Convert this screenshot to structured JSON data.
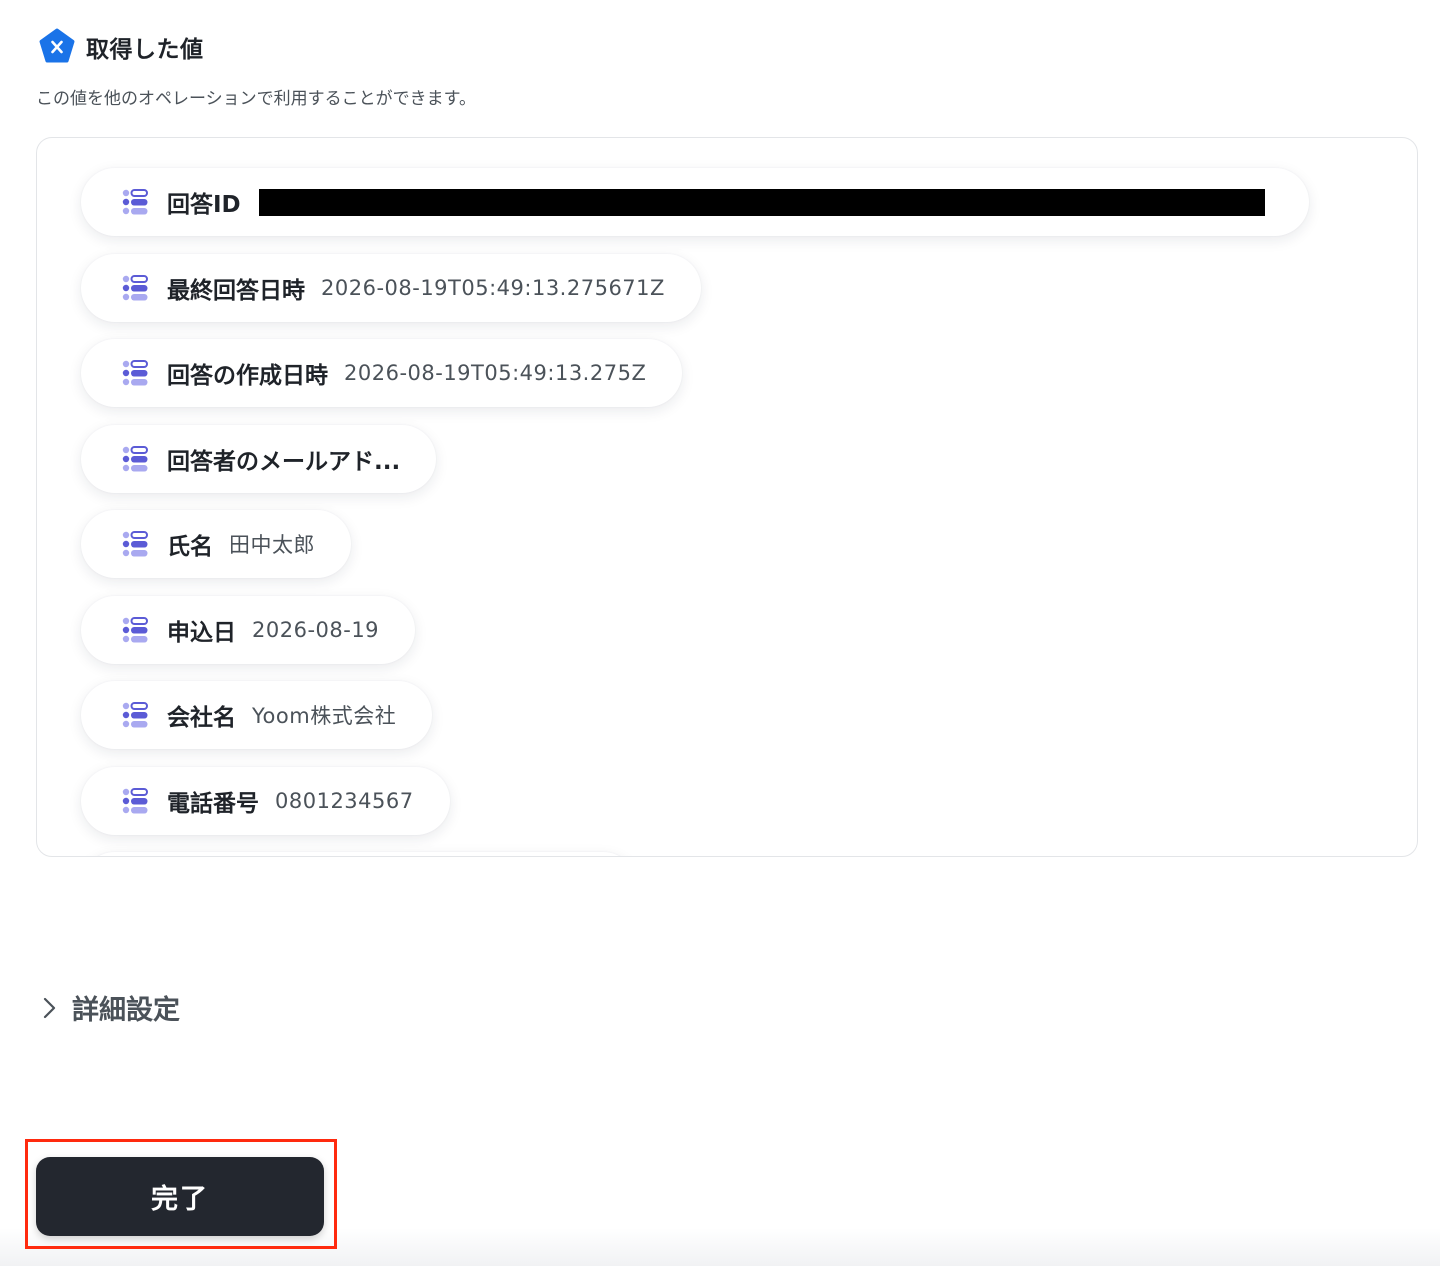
{
  "header": {
    "title": "取得した値",
    "logo_icon": "yoom-x-logo-icon",
    "logo_color": "#1a73e8"
  },
  "subtitle": "この値を他のオペレーションで利用することができます。",
  "variables": [
    {
      "label": "回答ID",
      "value": "",
      "redacted": true
    },
    {
      "label": "最終回答日時",
      "value": "2026-08-19T05:49:13.275671Z"
    },
    {
      "label": "回答の作成日時",
      "value": "2026-08-19T05:49:13.275Z"
    },
    {
      "label": "回答者のメールアド...",
      "value": ""
    },
    {
      "label": "氏名",
      "value": "田中太郎"
    },
    {
      "label": "申込日",
      "value": "2026-08-19"
    },
    {
      "label": "会社名",
      "value": "Yoom株式会社"
    },
    {
      "label": "電話番号",
      "value": "0801234567"
    }
  ],
  "variable_icon": "variable-list-icon",
  "variable_icon_colors": {
    "primary": "#5b5bd6",
    "secondary": "#a9a9f0"
  },
  "details": {
    "label": "詳細設定",
    "icon": "chevron-right-icon"
  },
  "footer": {
    "done_label": "完了",
    "button_color": "#23272f",
    "highlight_color": "#ff2a0e"
  }
}
